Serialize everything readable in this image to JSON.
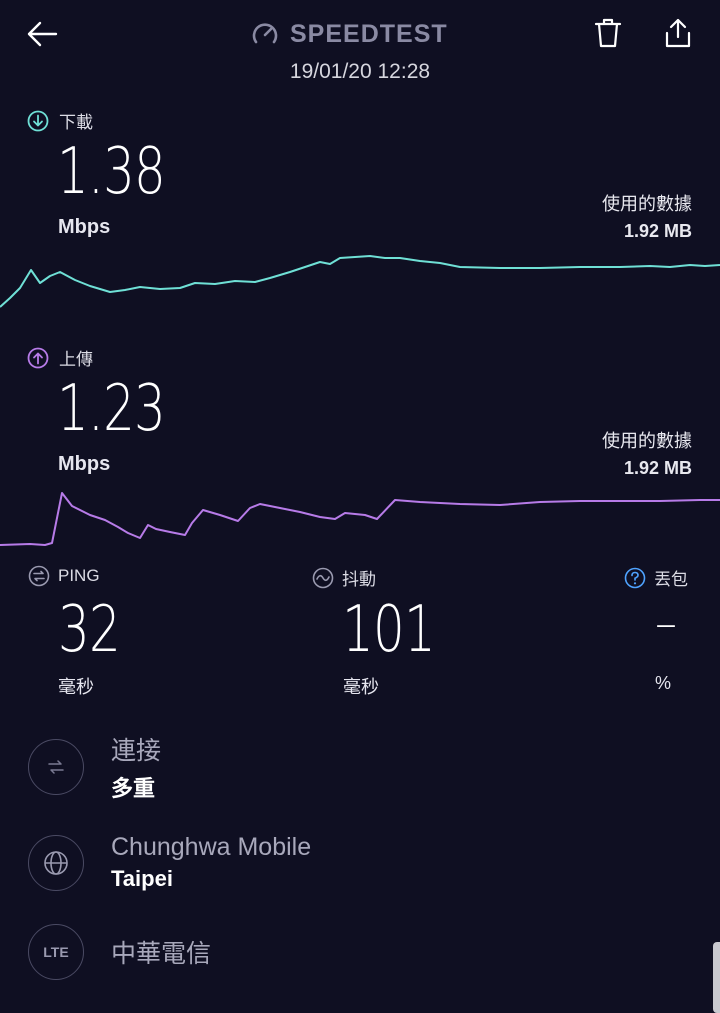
{
  "header": {
    "back_icon": "arrow-left-icon",
    "brand": "SPEEDTEST",
    "brand_icon": "speedometer-icon",
    "delete_icon": "trash-icon",
    "share_icon": "share-icon",
    "timestamp": "19/01/20 12:28"
  },
  "download": {
    "label": "下載",
    "value": "1.38",
    "unit": "Mbps",
    "data_used_label": "使用的數據",
    "data_used_value": "1.92 MB",
    "color": "#6fe0d6"
  },
  "upload": {
    "label": "上傳",
    "value": "1.23",
    "unit": "Mbps",
    "data_used_label": "使用的數據",
    "data_used_value": "1.92 MB",
    "color": "#b77be8"
  },
  "metrics": {
    "ping": {
      "label": "PING",
      "value": "32",
      "unit": "毫秒"
    },
    "jitter": {
      "label": "抖動",
      "value": "101",
      "unit": "毫秒"
    },
    "loss": {
      "label": "丟包",
      "value": "–",
      "unit": "%"
    }
  },
  "connection": {
    "title": "連接",
    "value": "多重"
  },
  "provider": {
    "title": "Chunghwa Mobile",
    "value": "Taipei"
  },
  "network": {
    "badge": "LTE",
    "title": "中華電信"
  },
  "colors": {
    "background": "#0f0f22",
    "accent_cyan": "#6fe0d6",
    "accent_purple": "#b77be8"
  }
}
